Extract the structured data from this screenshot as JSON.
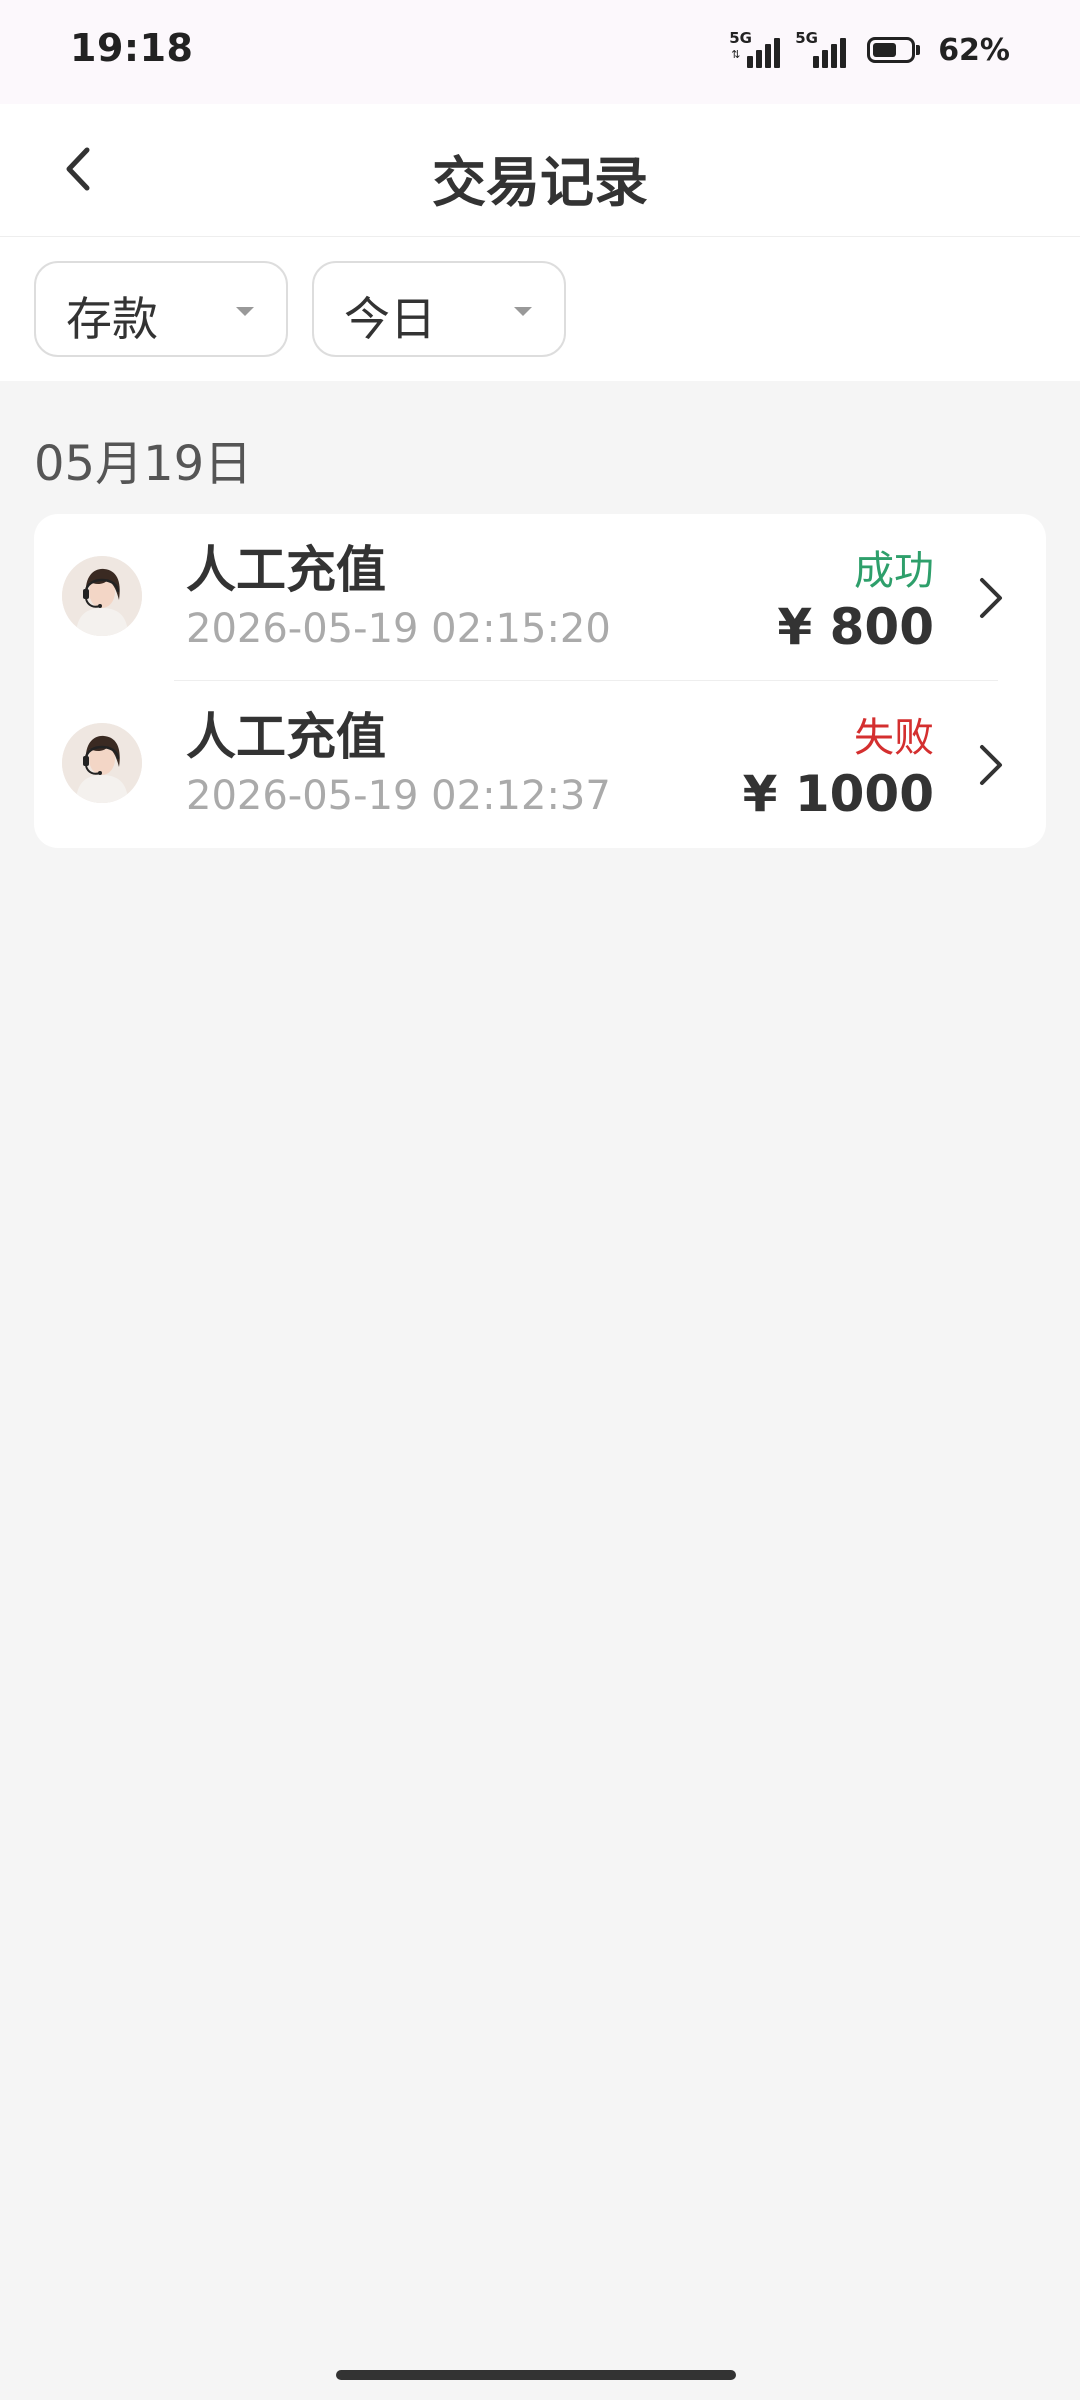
{
  "status_bar": {
    "time": "19:18",
    "sim1_network": "5G",
    "sim2_network": "5G",
    "battery_percent": "62%",
    "battery_level": 0.62
  },
  "header": {
    "title": "交易记录",
    "back_icon": "chevron-left-icon"
  },
  "filters": {
    "type_selected": "存款",
    "period_selected": "今日"
  },
  "groups": [
    {
      "date": "05月19日",
      "items": [
        {
          "title": "人工充值",
          "time": "2026-05-19 02:15:20",
          "status": "成功",
          "status_color": "#2e9f6b",
          "amount": "¥ 800"
        },
        {
          "title": "人工充值",
          "time": "2026-05-19 02:12:37",
          "status": "失败",
          "status_color": "#d42f2f",
          "amount": "¥ 1000"
        }
      ]
    }
  ],
  "colors": {
    "success": "#2e9f6b",
    "failure": "#d42f2f",
    "page_background": "#f5f5f5"
  }
}
